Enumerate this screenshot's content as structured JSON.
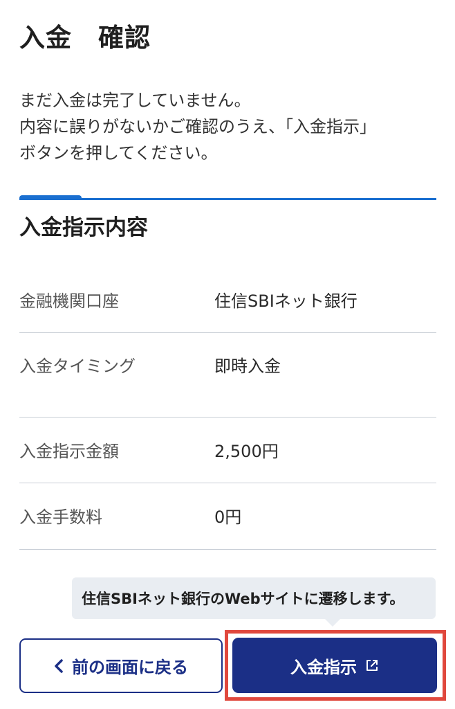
{
  "page": {
    "title": "入金　確認"
  },
  "intro": {
    "lines": [
      "まだ入金は完了していません。",
      "内容に誤りがないかご確認のうえ、「入金指示」",
      "ボタンを押してください。"
    ]
  },
  "section": {
    "title": "入金指示内容"
  },
  "details": [
    {
      "label": "金融機関口座",
      "value": "住信SBIネット銀行"
    },
    {
      "label": "入金タイミング",
      "value": "即時入金"
    },
    {
      "label": "入金指示金額",
      "value": "2,500円"
    },
    {
      "label": "入金手数料",
      "value": "0円"
    }
  ],
  "tooltip": {
    "text": "住信SBIネット銀行のWebサイトに遷移します。"
  },
  "buttons": {
    "back_label": "前の画面に戻る",
    "submit_label": "入金指示"
  },
  "icons": {
    "back": "chevron-left-icon",
    "submit": "external-link-icon"
  },
  "colors": {
    "primary": "#1b2f86",
    "accent_rule": "#1a6fd0",
    "highlight": "#e0483d",
    "tooltip_bg": "#e9edf2"
  }
}
